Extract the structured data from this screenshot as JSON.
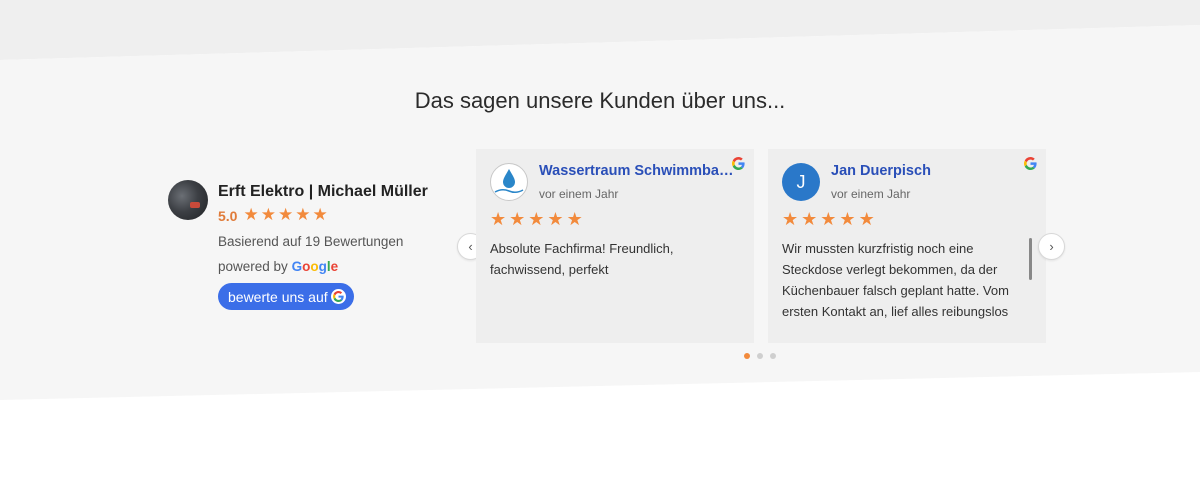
{
  "section": {
    "title": "Das sagen unsere Kunden über uns..."
  },
  "summary": {
    "business_name": "Erft Elektro | Michael Müller",
    "score": "5.0",
    "stars": 5,
    "based_on": "Basierend auf 19 Bewertungen",
    "powered_by": "powered by",
    "google_word": [
      "G",
      "o",
      "o",
      "g",
      "l",
      "e"
    ],
    "rate_button_label": "bewerte uns auf"
  },
  "reviews": [
    {
      "author": "Wassertraum Schwimmbad...",
      "avatar_text": "Wassertraum",
      "time": "vor einem Jahr",
      "stars": 5,
      "text": "Absolute Fachfirma! Freundlich, fachwissend, perfekt"
    },
    {
      "author": "Jan Duerpisch",
      "avatar_text": "J",
      "time": "vor einem Jahr",
      "stars": 5,
      "text": "Wir mussten kurzfristig noch eine Steckdose verlegt bekommen, da der Küchenbauer falsch geplant hatte. Vom ersten Kontakt an, lief alles reibungslos"
    }
  ],
  "navigation": {
    "prev_icon": "‹",
    "next_icon": "›"
  },
  "pagination": {
    "pages": 3,
    "active": 1
  },
  "colors": {
    "star": "#f28a3c",
    "author_link": "#2a4fb8",
    "button": "#3b6ee8",
    "active_dot": "#f28a3c",
    "band": "#f5f5f5"
  },
  "icons": {
    "star": "★",
    "google": "google-g-icon"
  }
}
